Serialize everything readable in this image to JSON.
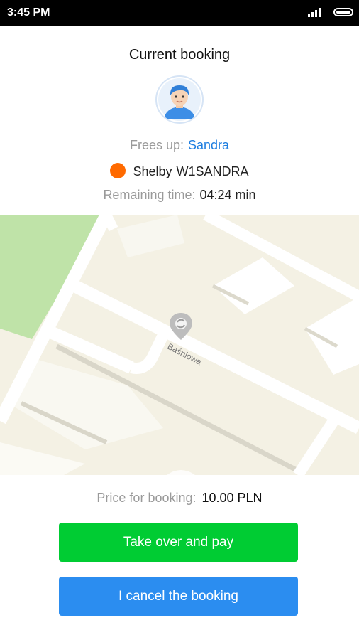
{
  "status_bar": {
    "time": "3:45 PM"
  },
  "header": {
    "title": "Current booking",
    "frees_up_label": "Frees up:",
    "frees_up_value": "Sandra",
    "car_name": "Shelby",
    "plate": "W1SANDRA",
    "remaining_label": "Remaining time:",
    "remaining_value": "04:24 min"
  },
  "map": {
    "street_label": "Baśniowa"
  },
  "bottom": {
    "price_label": "Price for booking:",
    "price_value": "10.00 PLN",
    "take_over_label": "Take over and pay",
    "cancel_label": "I cancel the booking"
  },
  "colors": {
    "accent_blue": "#1e7ee0",
    "green_button": "#00cc33",
    "blue_button": "#2b8df0",
    "car_dot": "#ff6a00"
  }
}
